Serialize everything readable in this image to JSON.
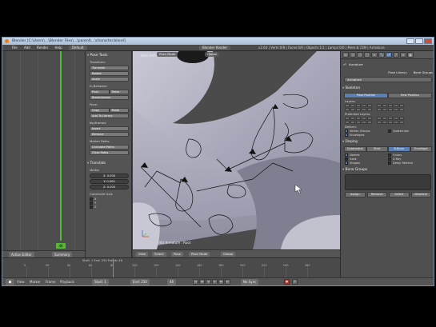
{
  "window": {
    "title": "Blender [C:\\Users\\...\\Blender Files\\...\\parent\\...\\character.blend]"
  },
  "menubar": {
    "items": [
      "File",
      "Add",
      "Render",
      "Help"
    ],
    "layout": "Default",
    "scene": "Blender Render",
    "stats": "v2.64 | Verts:0/8 | Faces:0/6 | Objects:1/1 | Lamps:0/0 | Mem:8.72M | Armature"
  },
  "graph": {
    "frame": "46",
    "header_left": "Action Editor",
    "header_right": "Summary"
  },
  "toolshelf": {
    "header": "Pose Tools",
    "transform": {
      "label": "Transform:",
      "buttons": [
        "Translate",
        "Rotate",
        "Scale"
      ]
    },
    "in_between": {
      "label": "In-Between:",
      "buttons": [
        "Push",
        "Relax",
        "Breakdowner"
      ]
    },
    "pose": {
      "label": "Pose:",
      "left": "Copy",
      "right": "Paste",
      "extra": "Add To Library"
    },
    "keyframes": {
      "label": "Keyframes:",
      "buttons": [
        "Insert",
        "Remove"
      ]
    },
    "motion": {
      "label": "Motion Paths:",
      "buttons": [
        "Calculate Paths",
        "Clear Paths"
      ]
    },
    "transform_panel": {
      "header": "Translate",
      "label": "Vector",
      "values": [
        "X: 0.000",
        "Y: 0.000",
        "Z: 0.000"
      ],
      "constraint_label": "Constraint Axis",
      "axes": [
        "X",
        "Y",
        "Z"
      ]
    }
  },
  "viewport": {
    "label": "User Ortho",
    "object": "(46) Armature : Root",
    "header": [
      "View",
      "Select",
      "Pose",
      "Pose Mode",
      "Global"
    ],
    "top": [
      "Pose Mode",
      "Global"
    ]
  },
  "timeline": {
    "status": "Start: 1  End: 250  Frame: 46",
    "ticks": [
      "0",
      "20",
      "40",
      "60",
      "80",
      "100",
      "120",
      "140",
      "160",
      "180",
      "200",
      "220",
      "240",
      "260"
    ]
  },
  "transport": {
    "items": [
      "View",
      "Marker",
      "Frame",
      "Playback"
    ],
    "start": "Start: 1",
    "end": "End: 250",
    "current": "46",
    "sync": "No Sync"
  },
  "props": {
    "object_name": "Armature",
    "tabs": [
      "Armature",
      "Pose Library",
      "Bone Groups"
    ],
    "active_tab": "Armature",
    "data_name": "Armature",
    "skeleton_header": "Skeleton",
    "position_buttons": [
      "Pose Position",
      "Rest Position"
    ],
    "active_position": "Pose Position",
    "layers_label": "Layers:",
    "protected_label": "Protected Layers:",
    "deform_label": "Deform:",
    "deform_opts": [
      "Vertex Groups",
      "Quaternion",
      "Envelopes"
    ],
    "display_header": "Display",
    "display_types": [
      "Octahedral",
      "Stick",
      "B-Bone",
      "Envelope"
    ],
    "active_display": "B-Bone",
    "display_opts": [
      "Names",
      "Colors",
      "Axes",
      "X-Ray",
      "Shapes",
      "Delay Refresh"
    ],
    "bone_groups_header": "Bone Groups",
    "bottom_buttons": [
      "Assign",
      "Remove",
      "Select",
      "Deselect"
    ]
  }
}
